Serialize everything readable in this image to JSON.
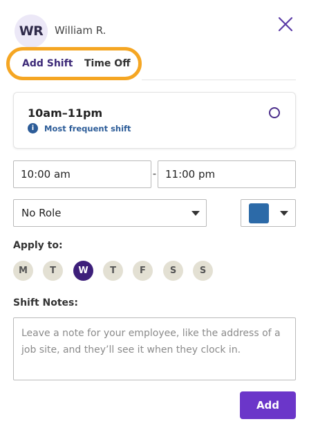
{
  "header": {
    "avatar_initials": "WR",
    "user_name": "William R.",
    "close_icon": "close-icon"
  },
  "tabs": [
    {
      "label": "Add Shift",
      "active": true
    },
    {
      "label": "Time Off",
      "active": false
    }
  ],
  "shift_suggestion": {
    "title": "10am–11pm",
    "subtitle": "Most frequent shift",
    "info_icon": "i"
  },
  "time": {
    "start": "10:00 am",
    "separator": "-",
    "end": "11:00 pm"
  },
  "role": {
    "selected": "No Role"
  },
  "color": {
    "selected_hex": "#2c6aa8"
  },
  "apply_to": {
    "label": "Apply to:",
    "days": [
      {
        "label": "M",
        "selected": false
      },
      {
        "label": "T",
        "selected": false
      },
      {
        "label": "W",
        "selected": true
      },
      {
        "label": "T",
        "selected": false
      },
      {
        "label": "F",
        "selected": false
      },
      {
        "label": "S",
        "selected": false
      },
      {
        "label": "S",
        "selected": false
      }
    ]
  },
  "notes": {
    "label": "Shift Notes:",
    "value": "",
    "placeholder": "Leave a note for your employee, like the address of a job site, and they’ll see it when they clock in."
  },
  "actions": {
    "add_label": "Add"
  },
  "colors": {
    "accent": "#6b36c9",
    "tab_highlight": "#f5a623",
    "selected_day": "#3d1f7a",
    "info": "#2c5c98"
  }
}
